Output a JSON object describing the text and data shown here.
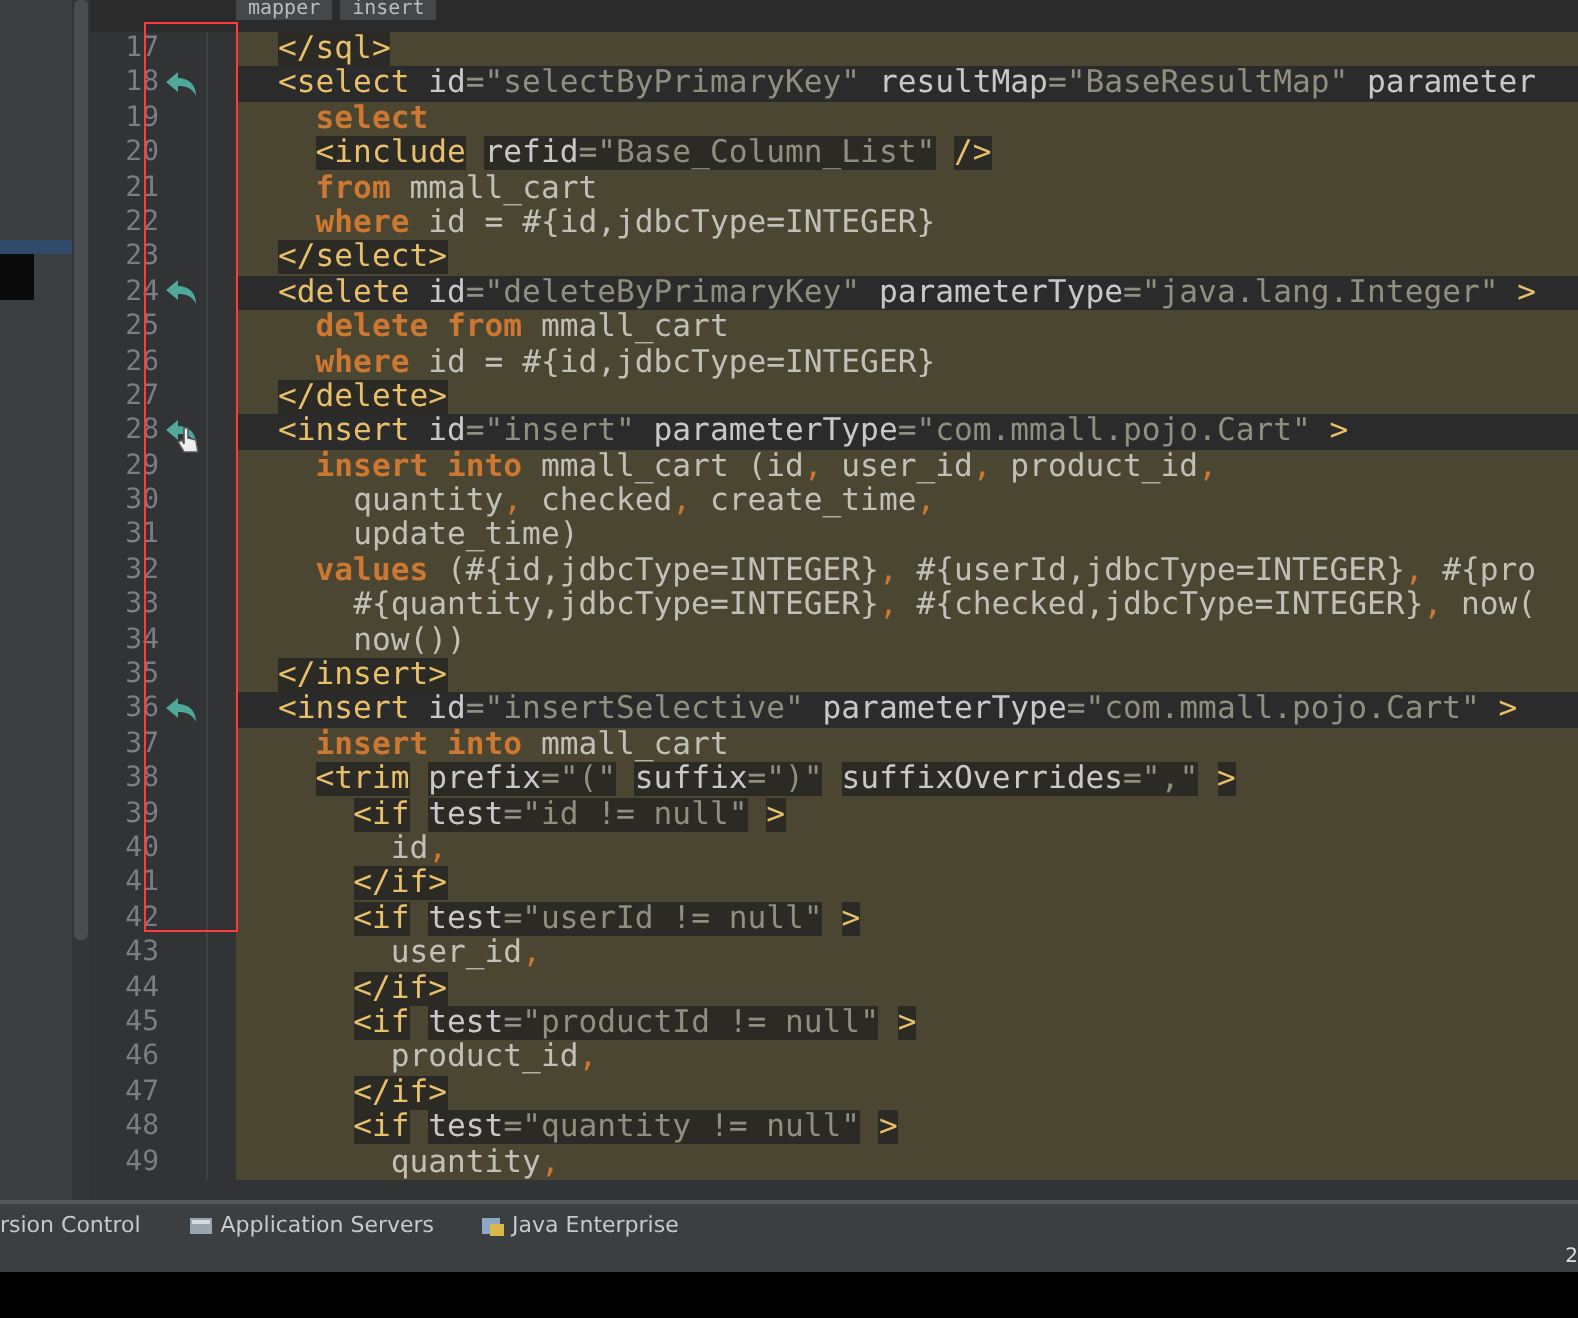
{
  "breadcrumbs": [
    {
      "label": "mapper"
    },
    {
      "label": "insert"
    }
  ],
  "editor": {
    "lines": [
      {
        "number": "17",
        "dark_band": false,
        "highlight": true,
        "marker": false,
        "pointer": false,
        "segments": [
          {
            "kind": "tag",
            "text": "</sql>"
          }
        ]
      },
      {
        "number": "18",
        "dark_band": true,
        "highlight": false,
        "marker": true,
        "pointer": false,
        "segments": [
          {
            "kind": "tag",
            "text": "<select"
          },
          {
            "kind": "attr",
            "text": " id"
          },
          {
            "kind": "value",
            "text": "=\"selectByPrimaryKey\""
          },
          {
            "kind": "attr",
            "text": " resultMap"
          },
          {
            "kind": "value",
            "text": "=\"BaseResultMap\""
          },
          {
            "kind": "attr",
            "text": " parameter"
          }
        ]
      },
      {
        "number": "19",
        "dark_band": false,
        "highlight": false,
        "marker": false,
        "pointer": false,
        "segments": [
          {
            "kind": "keyword",
            "text": "  select"
          }
        ]
      },
      {
        "number": "20",
        "dark_band": false,
        "highlight": true,
        "marker": false,
        "pointer": false,
        "segments": [
          {
            "kind": "tag",
            "text": "  <include"
          },
          {
            "kind": "attr",
            "text": " refid"
          },
          {
            "kind": "value",
            "text": "=\"Base_Column_List\""
          },
          {
            "kind": "tag",
            "text": " />"
          }
        ]
      },
      {
        "number": "21",
        "dark_band": false,
        "highlight": false,
        "marker": false,
        "pointer": false,
        "segments": [
          {
            "kind": "keyword",
            "text": "  from"
          },
          {
            "kind": "text",
            "text": " mmall_cart"
          }
        ]
      },
      {
        "number": "22",
        "dark_band": false,
        "highlight": false,
        "marker": false,
        "pointer": false,
        "segments": [
          {
            "kind": "keyword",
            "text": "  where"
          },
          {
            "kind": "text",
            "text": " id = #{id,jdbcType=INTEGER}"
          }
        ]
      },
      {
        "number": "23",
        "dark_band": false,
        "highlight": true,
        "marker": false,
        "pointer": false,
        "segments": [
          {
            "kind": "tag",
            "text": "</select>"
          }
        ]
      },
      {
        "number": "24",
        "dark_band": true,
        "highlight": false,
        "marker": true,
        "pointer": false,
        "segments": [
          {
            "kind": "tag",
            "text": "<delete"
          },
          {
            "kind": "attr",
            "text": " id"
          },
          {
            "kind": "value",
            "text": "=\"deleteByPrimaryKey\""
          },
          {
            "kind": "attr",
            "text": " parameterType"
          },
          {
            "kind": "value",
            "text": "=\"java.lang.Integer\""
          },
          {
            "kind": "tag",
            "text": " >"
          }
        ]
      },
      {
        "number": "25",
        "dark_band": false,
        "highlight": false,
        "marker": false,
        "pointer": false,
        "segments": [
          {
            "kind": "keyword",
            "text": "  delete from"
          },
          {
            "kind": "text",
            "text": " mmall_cart"
          }
        ]
      },
      {
        "number": "26",
        "dark_band": false,
        "highlight": false,
        "marker": false,
        "pointer": false,
        "segments": [
          {
            "kind": "keyword",
            "text": "  where"
          },
          {
            "kind": "text",
            "text": " id = #{id,jdbcType=INTEGER}"
          }
        ]
      },
      {
        "number": "27",
        "dark_band": false,
        "highlight": true,
        "marker": false,
        "pointer": false,
        "segments": [
          {
            "kind": "tag",
            "text": "</delete>"
          }
        ]
      },
      {
        "number": "28",
        "dark_band": true,
        "highlight": false,
        "marker": true,
        "pointer": true,
        "segments": [
          {
            "kind": "tag",
            "text": "<insert"
          },
          {
            "kind": "attr",
            "text": " id"
          },
          {
            "kind": "value",
            "text": "=\"insert\""
          },
          {
            "kind": "attr",
            "text": " parameterType"
          },
          {
            "kind": "value",
            "text": "=\"com.mmall.pojo.Cart\""
          },
          {
            "kind": "tag",
            "text": " >"
          }
        ]
      },
      {
        "number": "29",
        "dark_band": false,
        "highlight": false,
        "marker": false,
        "pointer": false,
        "segments": [
          {
            "kind": "keyword",
            "text": "  insert into"
          },
          {
            "kind": "text",
            "text": " mmall_cart (id"
          },
          {
            "kind": "punct",
            "text": ","
          },
          {
            "kind": "text",
            "text": " user_id"
          },
          {
            "kind": "punct",
            "text": ","
          },
          {
            "kind": "text",
            "text": " product_id"
          },
          {
            "kind": "punct",
            "text": ","
          }
        ]
      },
      {
        "number": "30",
        "dark_band": false,
        "highlight": false,
        "marker": false,
        "pointer": false,
        "segments": [
          {
            "kind": "text",
            "text": "    quantity"
          },
          {
            "kind": "punct",
            "text": ","
          },
          {
            "kind": "text",
            "text": " checked"
          },
          {
            "kind": "punct",
            "text": ","
          },
          {
            "kind": "text",
            "text": " create_time"
          },
          {
            "kind": "punct",
            "text": ","
          }
        ]
      },
      {
        "number": "31",
        "dark_band": false,
        "highlight": false,
        "marker": false,
        "pointer": false,
        "segments": [
          {
            "kind": "text",
            "text": "    update_time)"
          }
        ]
      },
      {
        "number": "32",
        "dark_band": false,
        "highlight": false,
        "marker": false,
        "pointer": false,
        "segments": [
          {
            "kind": "keyword",
            "text": "  values"
          },
          {
            "kind": "text",
            "text": " (#{id,jdbcType=INTEGER}"
          },
          {
            "kind": "punct",
            "text": ","
          },
          {
            "kind": "text",
            "text": " #{userId,jdbcType=INTEGER}"
          },
          {
            "kind": "punct",
            "text": ","
          },
          {
            "kind": "text",
            "text": " #{pro"
          }
        ]
      },
      {
        "number": "33",
        "dark_band": false,
        "highlight": false,
        "marker": false,
        "pointer": false,
        "segments": [
          {
            "kind": "text",
            "text": "    #{quantity,jdbcType=INTEGER}"
          },
          {
            "kind": "punct",
            "text": ","
          },
          {
            "kind": "text",
            "text": " #{checked,jdbcType=INTEGER}"
          },
          {
            "kind": "punct",
            "text": ","
          },
          {
            "kind": "text",
            "text": " now("
          }
        ]
      },
      {
        "number": "34",
        "dark_band": false,
        "highlight": false,
        "marker": false,
        "pointer": false,
        "segments": [
          {
            "kind": "text",
            "text": "    now())"
          }
        ]
      },
      {
        "number": "35",
        "dark_band": false,
        "highlight": true,
        "marker": false,
        "pointer": false,
        "segments": [
          {
            "kind": "tag",
            "text": "</insert>"
          }
        ]
      },
      {
        "number": "36",
        "dark_band": true,
        "highlight": false,
        "marker": true,
        "pointer": false,
        "segments": [
          {
            "kind": "tag",
            "text": "<insert"
          },
          {
            "kind": "attr",
            "text": " id"
          },
          {
            "kind": "value",
            "text": "=\"insertSelective\""
          },
          {
            "kind": "attr",
            "text": " parameterType"
          },
          {
            "kind": "value",
            "text": "=\"com.mmall.pojo.Cart\""
          },
          {
            "kind": "tag",
            "text": " >"
          }
        ]
      },
      {
        "number": "37",
        "dark_band": false,
        "highlight": false,
        "marker": false,
        "pointer": false,
        "segments": [
          {
            "kind": "keyword",
            "text": "  insert into"
          },
          {
            "kind": "text",
            "text": " mmall_cart"
          }
        ]
      },
      {
        "number": "38",
        "dark_band": false,
        "highlight": true,
        "marker": false,
        "pointer": false,
        "segments": [
          {
            "kind": "tag",
            "text": "  <trim"
          },
          {
            "kind": "attr",
            "text": " prefix"
          },
          {
            "kind": "value",
            "text": "=\"(\""
          },
          {
            "kind": "attr",
            "text": " suffix"
          },
          {
            "kind": "value",
            "text": "=\")\""
          },
          {
            "kind": "attr",
            "text": " suffixOverrides"
          },
          {
            "kind": "value",
            "text": "=\",\""
          },
          {
            "kind": "tag",
            "text": " >"
          }
        ]
      },
      {
        "number": "39",
        "dark_band": false,
        "highlight": true,
        "marker": false,
        "pointer": false,
        "segments": [
          {
            "kind": "tag",
            "text": "    <if"
          },
          {
            "kind": "attr",
            "text": " test"
          },
          {
            "kind": "value",
            "text": "=\"id != null\""
          },
          {
            "kind": "tag",
            "text": " >"
          }
        ]
      },
      {
        "number": "40",
        "dark_band": false,
        "highlight": false,
        "marker": false,
        "pointer": false,
        "segments": [
          {
            "kind": "text",
            "text": "      id"
          },
          {
            "kind": "punct",
            "text": ","
          }
        ]
      },
      {
        "number": "41",
        "dark_band": false,
        "highlight": true,
        "marker": false,
        "pointer": false,
        "segments": [
          {
            "kind": "tag",
            "text": "    </if>"
          }
        ]
      },
      {
        "number": "42",
        "dark_band": false,
        "highlight": true,
        "marker": false,
        "pointer": false,
        "segments": [
          {
            "kind": "tag",
            "text": "    <if"
          },
          {
            "kind": "attr",
            "text": " test"
          },
          {
            "kind": "value",
            "text": "=\"userId != null\""
          },
          {
            "kind": "tag",
            "text": " >"
          }
        ]
      },
      {
        "number": "43",
        "dark_band": false,
        "highlight": false,
        "marker": false,
        "pointer": false,
        "segments": [
          {
            "kind": "text",
            "text": "      user_id"
          },
          {
            "kind": "punct",
            "text": ","
          }
        ]
      },
      {
        "number": "44",
        "dark_band": false,
        "highlight": true,
        "marker": false,
        "pointer": false,
        "segments": [
          {
            "kind": "tag",
            "text": "    </if>"
          }
        ]
      },
      {
        "number": "45",
        "dark_band": false,
        "highlight": true,
        "marker": false,
        "pointer": false,
        "segments": [
          {
            "kind": "tag",
            "text": "    <if"
          },
          {
            "kind": "attr",
            "text": " test"
          },
          {
            "kind": "value",
            "text": "=\"productId != null\""
          },
          {
            "kind": "tag",
            "text": " >"
          }
        ]
      },
      {
        "number": "46",
        "dark_band": false,
        "highlight": false,
        "marker": false,
        "pointer": false,
        "segments": [
          {
            "kind": "text",
            "text": "      product_id"
          },
          {
            "kind": "punct",
            "text": ","
          }
        ]
      },
      {
        "number": "47",
        "dark_band": false,
        "highlight": true,
        "marker": false,
        "pointer": false,
        "segments": [
          {
            "kind": "tag",
            "text": "    </if>"
          }
        ]
      },
      {
        "number": "48",
        "dark_band": false,
        "highlight": true,
        "marker": false,
        "pointer": false,
        "segments": [
          {
            "kind": "tag",
            "text": "    <if"
          },
          {
            "kind": "attr",
            "text": " test"
          },
          {
            "kind": "value",
            "text": "=\"quantity != null\""
          },
          {
            "kind": "tag",
            "text": " >"
          }
        ]
      },
      {
        "number": "49",
        "dark_band": false,
        "highlight": false,
        "marker": false,
        "pointer": false,
        "segments": [
          {
            "kind": "text",
            "text": "      quantity"
          },
          {
            "kind": "punct",
            "text": ","
          }
        ]
      }
    ]
  },
  "tool_windows": [
    {
      "kind": "plain",
      "label": "rsion Control"
    },
    {
      "kind": "servers",
      "label": "Application Servers"
    },
    {
      "kind": "enterprise",
      "label": "Java Enterprise"
    }
  ],
  "status_bar": {
    "text": "2"
  }
}
